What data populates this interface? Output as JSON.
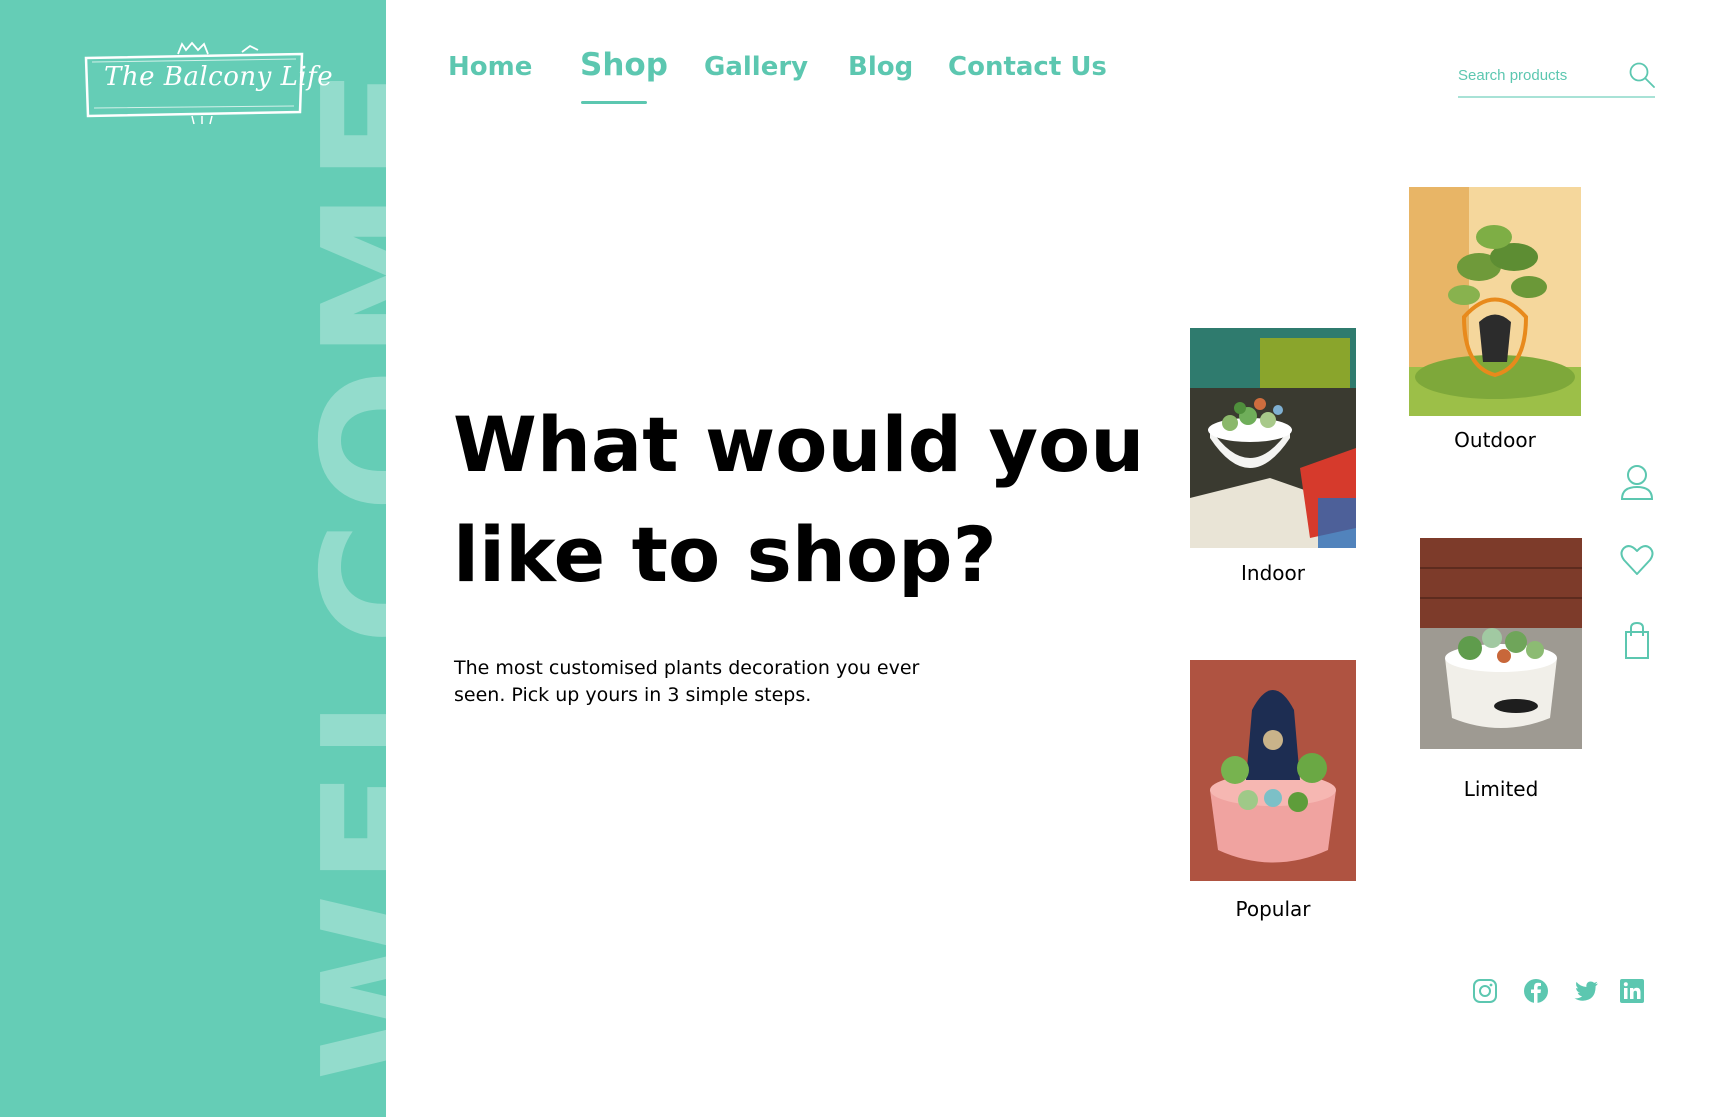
{
  "brand": {
    "name": "The Balcony Life"
  },
  "sidebar": {
    "welcome_text": "WELCOME",
    "background": "#65cdb6"
  },
  "nav": {
    "items": [
      {
        "label": "Home"
      },
      {
        "label": "Shop",
        "active": true
      },
      {
        "label": "Gallery"
      },
      {
        "label": "Blog"
      },
      {
        "label": "Contact Us"
      }
    ]
  },
  "search": {
    "placeholder": "Search products",
    "value": "",
    "icon": "search-icon"
  },
  "hero": {
    "title_line1": "What would you",
    "title_line2": "like to shop?",
    "subtitle_line1": "The most customised plants decoration you ever",
    "subtitle_line2": "seen. Pick up yours in 3 simple steps."
  },
  "categories": [
    {
      "label": "Indoor"
    },
    {
      "label": "Outdoor"
    },
    {
      "label": "Limited"
    },
    {
      "label": "Popular"
    }
  ],
  "side_icons": [
    "user-icon",
    "heart-icon",
    "shopping-bag-icon"
  ],
  "social": [
    "instagram-icon",
    "facebook-icon",
    "twitter-icon",
    "linkedin-icon"
  ],
  "colors": {
    "accent": "#5cc7b0",
    "sidebar": "#65cdb6",
    "text": "#000000"
  }
}
